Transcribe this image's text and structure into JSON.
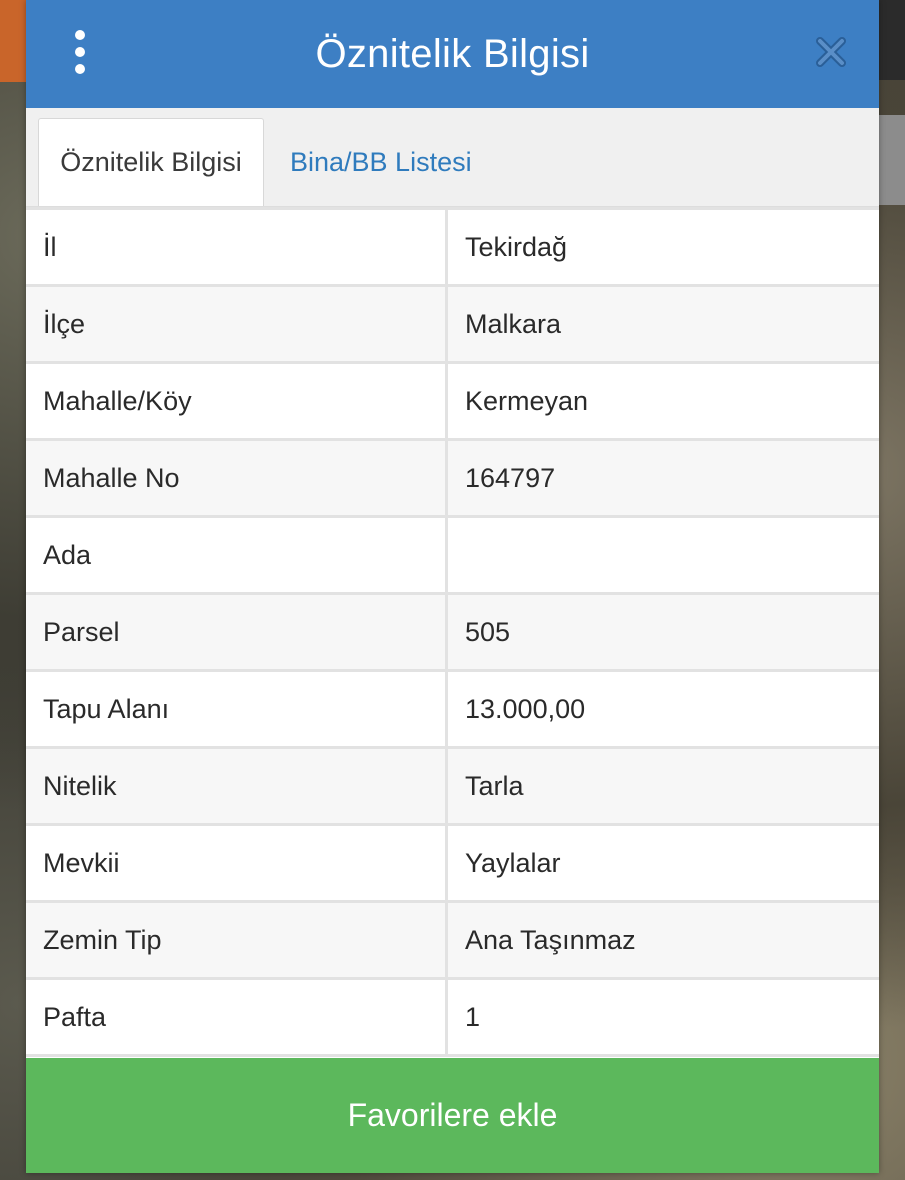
{
  "header": {
    "title": "Öznitelik Bilgisi",
    "menu_icon": "kebab-menu-icon",
    "close_icon": "close-icon",
    "color": "#3d7fc4"
  },
  "tabs": [
    {
      "label": "Öznitelik Bilgisi",
      "active": true
    },
    {
      "label": "Bina/BB Listesi",
      "active": false
    }
  ],
  "rows": [
    {
      "key": "İl",
      "value": "Tekirdağ"
    },
    {
      "key": "İlçe",
      "value": "Malkara"
    },
    {
      "key": "Mahalle/Köy",
      "value": "Kermeyan"
    },
    {
      "key": "Mahalle No",
      "value": "164797"
    },
    {
      "key": "Ada",
      "value": ""
    },
    {
      "key": "Parsel",
      "value": "505"
    },
    {
      "key": "Tapu Alanı",
      "value": "13.000,00"
    },
    {
      "key": "Nitelik",
      "value": "Tarla"
    },
    {
      "key": "Mevkii",
      "value": "Yaylalar"
    },
    {
      "key": "Zemin Tip",
      "value": "Ana Taşınmaz"
    },
    {
      "key": "Pafta",
      "value": "1"
    }
  ],
  "footer": {
    "favorite_label": "Favorilere ekle",
    "color": "#5cb85c"
  }
}
